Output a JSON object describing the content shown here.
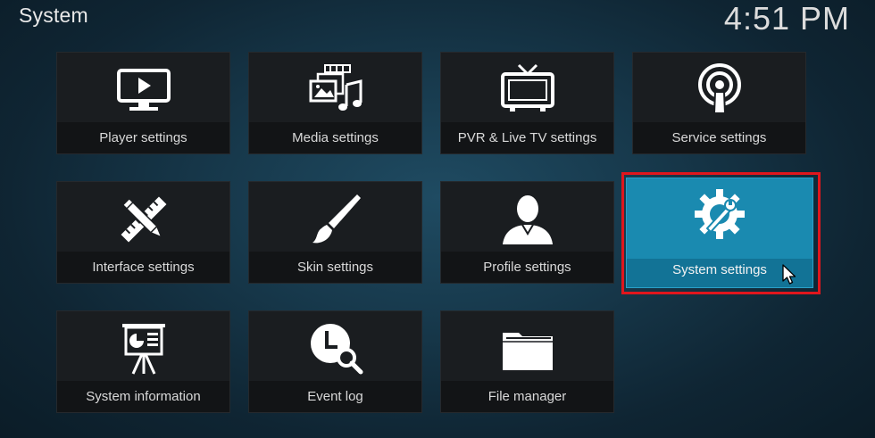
{
  "header": {
    "title": "System",
    "clock": "4:51 PM"
  },
  "tiles": [
    {
      "label": "Player settings",
      "icon": "monitor-play-icon"
    },
    {
      "label": "Media settings",
      "icon": "media-picture-music-icon"
    },
    {
      "label": "PVR & Live TV settings",
      "icon": "tv-icon"
    },
    {
      "label": "Service settings",
      "icon": "broadcast-icon"
    },
    {
      "label": "Interface settings",
      "icon": "pencil-ruler-icon"
    },
    {
      "label": "Skin settings",
      "icon": "paintbrush-icon"
    },
    {
      "label": "Profile settings",
      "icon": "user-profile-icon"
    },
    {
      "label": "System settings",
      "icon": "gear-wrench-icon",
      "focused": true
    },
    {
      "label": "System information",
      "icon": "presentation-board-icon"
    },
    {
      "label": "Event log",
      "icon": "clock-search-icon"
    },
    {
      "label": "File manager",
      "icon": "folder-icon"
    }
  ],
  "colors": {
    "focus": "#1a8ab0",
    "highlight": "#e0161d"
  }
}
